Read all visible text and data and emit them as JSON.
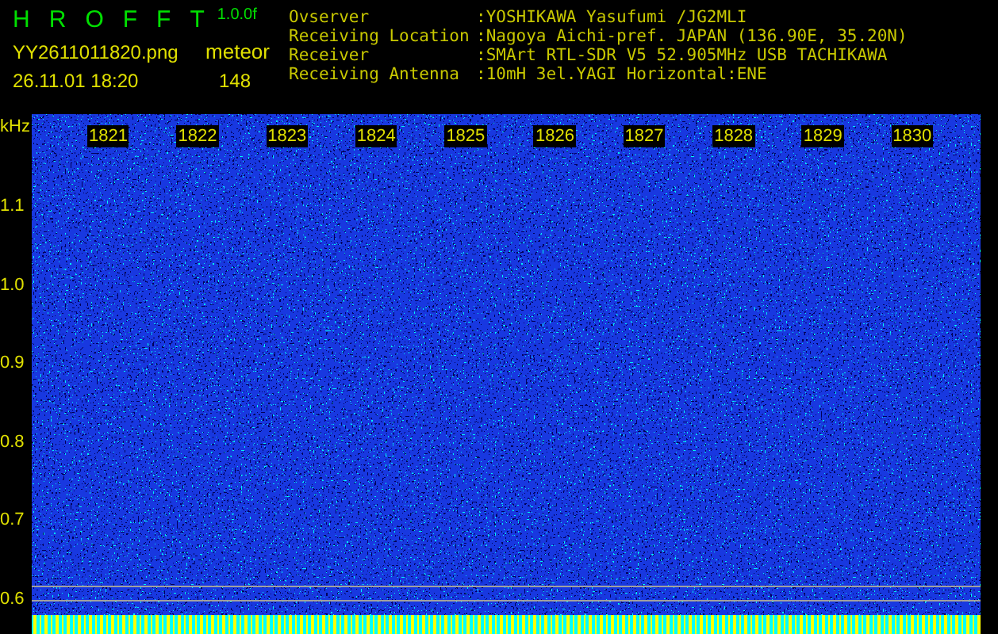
{
  "app": {
    "title_letters": [
      "H",
      "R",
      "O",
      "F",
      "F",
      "T"
    ],
    "version": "1.0.0f",
    "filename": "YY2611011820.png",
    "datetime": "26.11.01 18:20",
    "mode": "meteor",
    "count": "148"
  },
  "info": [
    {
      "label": "Ovserver",
      "value": ":YOSHIKAWA Yasufumi /JG2MLI"
    },
    {
      "label": "Receiving Location",
      "value": ":Nagoya Aichi-pref. JAPAN (136.90E, 35.20N)"
    },
    {
      "label": "Receiver",
      "value": ":SMArt RTL-SDR V5 52.905MHz USB TACHIKAWA"
    },
    {
      "label": "Receiving Antenna",
      "value": ":10mH 3el.YAGI Horizontal:ENE"
    }
  ],
  "y_axis": {
    "unit": "kHz",
    "labels": [
      "1.1",
      "1.0",
      "0.9",
      "0.8",
      "0.7",
      "0.6"
    ]
  },
  "time_labels": [
    "1821",
    "1822",
    "1823",
    "1824",
    "1825",
    "1826",
    "1827",
    "1828",
    "1829",
    "1830"
  ]
}
